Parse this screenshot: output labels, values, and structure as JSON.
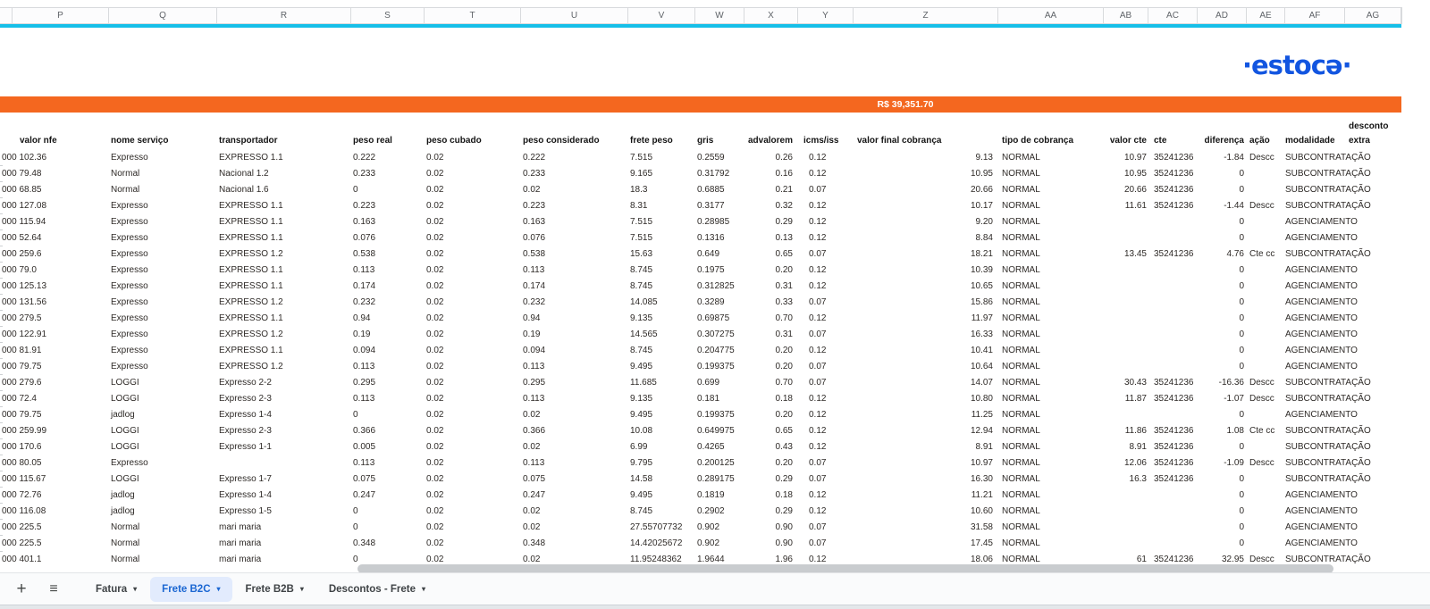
{
  "column_letters": [
    "P",
    "Q",
    "R",
    "S",
    "T",
    "U",
    "V",
    "W",
    "X",
    "Y",
    "Z",
    "AA",
    "AB",
    "AC",
    "AD",
    "AE",
    "AF",
    "AG"
  ],
  "logo": {
    "text": "·estocə·"
  },
  "banner": {
    "amount": "R$ 39,351.70"
  },
  "colors": {
    "banner_orange": "#f4671f",
    "logo_blue": "#1255e0",
    "frozen_divider_cyan": "#17bfe8",
    "active_tab_blue": "#1a66d2"
  },
  "table": {
    "headers": {
      "nfe": "valor nfe",
      "servico": "nome serviço",
      "transp": "transportador",
      "preal": "peso real",
      "pcub": "peso cubado",
      "pcons": "peso considerado",
      "frete": "frete peso",
      "gris": "gris",
      "adv": "advalorem",
      "icms": "icms/iss",
      "vfinal": "valor final cobrança",
      "tipo": "tipo de cobrança",
      "vcte": "valor cte",
      "cte": "cte",
      "dif": "diferença",
      "acao": "ação",
      "mod": "modalidade",
      "extra": "extra",
      "extra_top": "desconto"
    },
    "rows": [
      {
        "nfe": "000 102.36",
        "servico": "Expresso",
        "transp": "EXPRESSO 1.1",
        "preal": "0.222",
        "pcub": "0.02",
        "pcons": "0.222",
        "frete": "7.515",
        "gris": "0.2559",
        "adv": "0.26",
        "icms": "0.12",
        "vfinal": "9.13",
        "tipo": "NORMAL",
        "vcte": "10.97",
        "cte": "35241236",
        "dif": "-1.84",
        "acao": "Descc",
        "mod": "SUBCONTRATAÇÃO",
        "extra": ""
      },
      {
        "nfe": "000 79.48",
        "servico": "Normal",
        "transp": "Nacional 1.2",
        "preal": "0.233",
        "pcub": "0.02",
        "pcons": "0.233",
        "frete": "9.165",
        "gris": "0.31792",
        "adv": "0.16",
        "icms": "0.12",
        "vfinal": "10.95",
        "tipo": "NORMAL",
        "vcte": "10.95",
        "cte": "35241236",
        "dif": "0",
        "acao": "",
        "mod": "SUBCONTRATAÇÃO",
        "extra": ""
      },
      {
        "nfe": "000 68.85",
        "servico": "Normal",
        "transp": "Nacional 1.6",
        "preal": "0",
        "pcub": "0.02",
        "pcons": "0.02",
        "frete": "18.3",
        "gris": "0.6885",
        "adv": "0.21",
        "icms": "0.07",
        "vfinal": "20.66",
        "tipo": "NORMAL",
        "vcte": "20.66",
        "cte": "35241236",
        "dif": "0",
        "acao": "",
        "mod": "SUBCONTRATAÇÃO",
        "extra": ""
      },
      {
        "nfe": "000 127.08",
        "servico": "Expresso",
        "transp": "EXPRESSO 1.1",
        "preal": "0.223",
        "pcub": "0.02",
        "pcons": "0.223",
        "frete": "8.31",
        "gris": "0.3177",
        "adv": "0.32",
        "icms": "0.12",
        "vfinal": "10.17",
        "tipo": "NORMAL",
        "vcte": "11.61",
        "cte": "35241236",
        "dif": "-1.44",
        "acao": "Descc",
        "mod": "SUBCONTRATAÇÃO",
        "extra": ""
      },
      {
        "nfe": "000 115.94",
        "servico": "Expresso",
        "transp": "EXPRESSO 1.1",
        "preal": "0.163",
        "pcub": "0.02",
        "pcons": "0.163",
        "frete": "7.515",
        "gris": "0.28985",
        "adv": "0.29",
        "icms": "0.12",
        "vfinal": "9.20",
        "tipo": "NORMAL",
        "vcte": "",
        "cte": "",
        "dif": "0",
        "acao": "",
        "mod": "AGENCIAMENTO",
        "extra": ""
      },
      {
        "nfe": "000 52.64",
        "servico": "Expresso",
        "transp": "EXPRESSO 1.1",
        "preal": "0.076",
        "pcub": "0.02",
        "pcons": "0.076",
        "frete": "7.515",
        "gris": "0.1316",
        "adv": "0.13",
        "icms": "0.12",
        "vfinal": "8.84",
        "tipo": "NORMAL",
        "vcte": "",
        "cte": "",
        "dif": "0",
        "acao": "",
        "mod": "AGENCIAMENTO",
        "extra": ""
      },
      {
        "nfe": "000 259.6",
        "servico": "Expresso",
        "transp": "EXPRESSO 1.2",
        "preal": "0.538",
        "pcub": "0.02",
        "pcons": "0.538",
        "frete": "15.63",
        "gris": "0.649",
        "adv": "0.65",
        "icms": "0.07",
        "vfinal": "18.21",
        "tipo": "NORMAL",
        "vcte": "13.45",
        "cte": "35241236",
        "dif": "4.76",
        "acao": "Cte cc",
        "mod": "SUBCONTRATAÇÃO",
        "extra": ""
      },
      {
        "nfe": "000 79.0",
        "servico": "Expresso",
        "transp": "EXPRESSO 1.1",
        "preal": "0.113",
        "pcub": "0.02",
        "pcons": "0.113",
        "frete": "8.745",
        "gris": "0.1975",
        "adv": "0.20",
        "icms": "0.12",
        "vfinal": "10.39",
        "tipo": "NORMAL",
        "vcte": "",
        "cte": "",
        "dif": "0",
        "acao": "",
        "mod": "AGENCIAMENTO",
        "extra": ""
      },
      {
        "nfe": "000 125.13",
        "servico": "Expresso",
        "transp": "EXPRESSO 1.1",
        "preal": "0.174",
        "pcub": "0.02",
        "pcons": "0.174",
        "frete": "8.745",
        "gris": "0.312825",
        "adv": "0.31",
        "icms": "0.12",
        "vfinal": "10.65",
        "tipo": "NORMAL",
        "vcte": "",
        "cte": "",
        "dif": "0",
        "acao": "",
        "mod": "AGENCIAMENTO",
        "extra": ""
      },
      {
        "nfe": "000 131.56",
        "servico": "Expresso",
        "transp": "EXPRESSO 1.2",
        "preal": "0.232",
        "pcub": "0.02",
        "pcons": "0.232",
        "frete": "14.085",
        "gris": "0.3289",
        "adv": "0.33",
        "icms": "0.07",
        "vfinal": "15.86",
        "tipo": "NORMAL",
        "vcte": "",
        "cte": "",
        "dif": "0",
        "acao": "",
        "mod": "AGENCIAMENTO",
        "extra": ""
      },
      {
        "nfe": "000 279.5",
        "servico": "Expresso",
        "transp": "EXPRESSO 1.1",
        "preal": "0.94",
        "pcub": "0.02",
        "pcons": "0.94",
        "frete": "9.135",
        "gris": "0.69875",
        "adv": "0.70",
        "icms": "0.12",
        "vfinal": "11.97",
        "tipo": "NORMAL",
        "vcte": "",
        "cte": "",
        "dif": "0",
        "acao": "",
        "mod": "AGENCIAMENTO",
        "extra": ""
      },
      {
        "nfe": "000 122.91",
        "servico": "Expresso",
        "transp": "EXPRESSO 1.2",
        "preal": "0.19",
        "pcub": "0.02",
        "pcons": "0.19",
        "frete": "14.565",
        "gris": "0.307275",
        "adv": "0.31",
        "icms": "0.07",
        "vfinal": "16.33",
        "tipo": "NORMAL",
        "vcte": "",
        "cte": "",
        "dif": "0",
        "acao": "",
        "mod": "AGENCIAMENTO",
        "extra": ""
      },
      {
        "nfe": "000 81.91",
        "servico": "Expresso",
        "transp": "EXPRESSO 1.1",
        "preal": "0.094",
        "pcub": "0.02",
        "pcons": "0.094",
        "frete": "8.745",
        "gris": "0.204775",
        "adv": "0.20",
        "icms": "0.12",
        "vfinal": "10.41",
        "tipo": "NORMAL",
        "vcte": "",
        "cte": "",
        "dif": "0",
        "acao": "",
        "mod": "AGENCIAMENTO",
        "extra": ""
      },
      {
        "nfe": "000 79.75",
        "servico": "Expresso",
        "transp": "EXPRESSO 1.2",
        "preal": "0.113",
        "pcub": "0.02",
        "pcons": "0.113",
        "frete": "9.495",
        "gris": "0.199375",
        "adv": "0.20",
        "icms": "0.07",
        "vfinal": "10.64",
        "tipo": "NORMAL",
        "vcte": "",
        "cte": "",
        "dif": "0",
        "acao": "",
        "mod": "AGENCIAMENTO",
        "extra": ""
      },
      {
        "nfe": "000 279.6",
        "servico": "LOGGI",
        "transp": "Expresso 2-2",
        "preal": "0.295",
        "pcub": "0.02",
        "pcons": "0.295",
        "frete": "11.685",
        "gris": "0.699",
        "adv": "0.70",
        "icms": "0.07",
        "vfinal": "14.07",
        "tipo": "NORMAL",
        "vcte": "30.43",
        "cte": "35241236",
        "dif": "-16.36",
        "acao": "Descc",
        "mod": "SUBCONTRATAÇÃO",
        "extra": ""
      },
      {
        "nfe": "000 72.4",
        "servico": "LOGGI",
        "transp": "Expresso 2-3",
        "preal": "0.113",
        "pcub": "0.02",
        "pcons": "0.113",
        "frete": "9.135",
        "gris": "0.181",
        "adv": "0.18",
        "icms": "0.12",
        "vfinal": "10.80",
        "tipo": "NORMAL",
        "vcte": "11.87",
        "cte": "35241236",
        "dif": "-1.07",
        "acao": "Descc",
        "mod": "SUBCONTRATAÇÃO",
        "extra": ""
      },
      {
        "nfe": "000 79.75",
        "servico": "jadlog",
        "transp": "Expresso 1-4",
        "preal": "0",
        "pcub": "0.02",
        "pcons": "0.02",
        "frete": "9.495",
        "gris": "0.199375",
        "adv": "0.20",
        "icms": "0.12",
        "vfinal": "11.25",
        "tipo": "NORMAL",
        "vcte": "",
        "cte": "",
        "dif": "0",
        "acao": "",
        "mod": "AGENCIAMENTO",
        "extra": ""
      },
      {
        "nfe": "000 259.99",
        "servico": "LOGGI",
        "transp": "Expresso 2-3",
        "preal": "0.366",
        "pcub": "0.02",
        "pcons": "0.366",
        "frete": "10.08",
        "gris": "0.649975",
        "adv": "0.65",
        "icms": "0.12",
        "vfinal": "12.94",
        "tipo": "NORMAL",
        "vcte": "11.86",
        "cte": "35241236",
        "dif": "1.08",
        "acao": "Cte cc",
        "mod": "SUBCONTRATAÇÃO",
        "extra": ""
      },
      {
        "nfe": "000 170.6",
        "servico": "LOGGI",
        "transp": "Expresso 1-1",
        "preal": "0.005",
        "pcub": "0.02",
        "pcons": "0.02",
        "frete": "6.99",
        "gris": "0.4265",
        "adv": "0.43",
        "icms": "0.12",
        "vfinal": "8.91",
        "tipo": "NORMAL",
        "vcte": "8.91",
        "cte": "35241236",
        "dif": "0",
        "acao": "",
        "mod": "SUBCONTRATAÇÃO",
        "extra": ""
      },
      {
        "nfe": "000 80.05",
        "servico": "Expresso",
        "transp": "",
        "preal": "0.113",
        "pcub": "0.02",
        "pcons": "0.113",
        "frete": "9.795",
        "gris": "0.200125",
        "adv": "0.20",
        "icms": "0.07",
        "vfinal": "10.97",
        "tipo": "NORMAL",
        "vcte": "12.06",
        "cte": "35241236",
        "dif": "-1.09",
        "acao": "Descc",
        "mod": "SUBCONTRATAÇÃO",
        "extra": ""
      },
      {
        "nfe": "000 115.67",
        "servico": "LOGGI",
        "transp": "Expresso 1-7",
        "preal": "0.075",
        "pcub": "0.02",
        "pcons": "0.075",
        "frete": "14.58",
        "gris": "0.289175",
        "adv": "0.29",
        "icms": "0.07",
        "vfinal": "16.30",
        "tipo": "NORMAL",
        "vcte": "16.3",
        "cte": "35241236",
        "dif": "0",
        "acao": "",
        "mod": "SUBCONTRATAÇÃO",
        "extra": ""
      },
      {
        "nfe": "000 72.76",
        "servico": "jadlog",
        "transp": "Expresso 1-4",
        "preal": "0.247",
        "pcub": "0.02",
        "pcons": "0.247",
        "frete": "9.495",
        "gris": "0.1819",
        "adv": "0.18",
        "icms": "0.12",
        "vfinal": "11.21",
        "tipo": "NORMAL",
        "vcte": "",
        "cte": "",
        "dif": "0",
        "acao": "",
        "mod": "AGENCIAMENTO",
        "extra": ""
      },
      {
        "nfe": "000 116.08",
        "servico": "jadlog",
        "transp": "Expresso 1-5",
        "preal": "0",
        "pcub": "0.02",
        "pcons": "0.02",
        "frete": "8.745",
        "gris": "0.2902",
        "adv": "0.29",
        "icms": "0.12",
        "vfinal": "10.60",
        "tipo": "NORMAL",
        "vcte": "",
        "cte": "",
        "dif": "0",
        "acao": "",
        "mod": "AGENCIAMENTO",
        "extra": ""
      },
      {
        "nfe": "000 225.5",
        "servico": "Normal",
        "transp": "mari maria",
        "preal": "0",
        "pcub": "0.02",
        "pcons": "0.02",
        "frete": "27.55707732",
        "gris": "0.902",
        "adv": "0.90",
        "icms": "0.07",
        "vfinal": "31.58",
        "tipo": "NORMAL",
        "vcte": "",
        "cte": "",
        "dif": "0",
        "acao": "",
        "mod": "AGENCIAMENTO",
        "extra": ""
      },
      {
        "nfe": "000 225.5",
        "servico": "Normal",
        "transp": "mari maria",
        "preal": "0.348",
        "pcub": "0.02",
        "pcons": "0.348",
        "frete": "14.42025672",
        "gris": "0.902",
        "adv": "0.90",
        "icms": "0.07",
        "vfinal": "17.45",
        "tipo": "NORMAL",
        "vcte": "",
        "cte": "",
        "dif": "0",
        "acao": "",
        "mod": "AGENCIAMENTO",
        "extra": ""
      },
      {
        "nfe": "000 401.1",
        "servico": "Normal",
        "transp": "mari maria",
        "preal": "0",
        "pcub": "0.02",
        "pcons": "0.02",
        "frete": "11.95248362",
        "gris": "1.9644",
        "adv": "1.96",
        "icms": "0.12",
        "vfinal": "18.06",
        "tipo": "NORMAL",
        "vcte": "61",
        "cte": "35241236",
        "dif": "32.95",
        "acao": "Descc",
        "mod": "SUBCONTRATAÇÃO",
        "extra": ""
      }
    ]
  },
  "tabbar": {
    "add_icon": "+",
    "menu_icon": "≡",
    "caret_icon": "▾",
    "tabs": [
      {
        "label": "Fatura",
        "active": false
      },
      {
        "label": "Frete B2C",
        "active": true
      },
      {
        "label": "Frete B2B",
        "active": false
      },
      {
        "label": "Descontos - Frete",
        "active": false
      }
    ]
  }
}
